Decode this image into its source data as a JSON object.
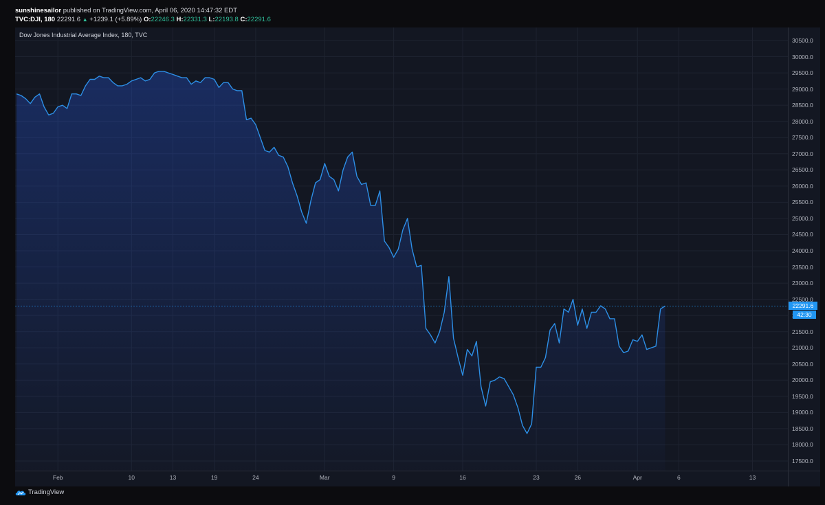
{
  "header": {
    "user": "sunshinesailor",
    "published": "published on TradingView.com, April 06, 2020 14:47:32 EDT",
    "symbol": "TVC:DJI, 180",
    "last": "22291.6",
    "change": "+1239.1 (+5.89%)",
    "o_label": "O:",
    "o_value": "22246.3",
    "h_label": "H:",
    "h_value": "22331.3",
    "l_label": "L:",
    "l_value": "22193.8",
    "c_label": "C:",
    "c_value": "22291.6"
  },
  "price_tag": "22291.6",
  "timer_tag": "42:30",
  "logo_text": "TradingView",
  "colors": {
    "line": "#2d8fe6",
    "accent": "#2196f3",
    "green": "#2fbf9b"
  },
  "chart_data": {
    "type": "area",
    "title": "Dow Jones Industrial Average Index, 180, TVC",
    "ylim": [
      17000,
      31000
    ],
    "yticks": [
      "30500.0",
      "30000.0",
      "29500.0",
      "29000.0",
      "28500.0",
      "28000.0",
      "27500.0",
      "27000.0",
      "26500.0",
      "26000.0",
      "25500.0",
      "25000.0",
      "24500.0",
      "24000.0",
      "23500.0",
      "23000.0",
      "22500.0",
      "22000.0",
      "21500.0",
      "21000.0",
      "20500.0",
      "20000.0",
      "19500.0",
      "19000.0",
      "18500.0",
      "18000.0",
      "17500.0"
    ],
    "xticks": [
      {
        "label": "Feb",
        "i": 9
      },
      {
        "label": "10",
        "i": 25
      },
      {
        "label": "13",
        "i": 34
      },
      {
        "label": "19",
        "i": 43
      },
      {
        "label": "24",
        "i": 52
      },
      {
        "label": "Mar",
        "i": 67
      },
      {
        "label": "9",
        "i": 82
      },
      {
        "label": "16",
        "i": 97
      },
      {
        "label": "23",
        "i": 113
      },
      {
        "label": "26",
        "i": 122
      },
      {
        "label": "Apr",
        "i": 135
      },
      {
        "label": "6",
        "i": 144
      },
      {
        "label": "13",
        "i": 160
      }
    ],
    "n_slots": 168,
    "last_value": 22291.6,
    "values": [
      28850,
      28800,
      28700,
      28550,
      28750,
      28850,
      28450,
      28200,
      28250,
      28450,
      28500,
      28400,
      28850,
      28850,
      28800,
      29100,
      29300,
      29300,
      29400,
      29350,
      29350,
      29200,
      29100,
      29100,
      29150,
      29250,
      29300,
      29350,
      29250,
      29300,
      29500,
      29550,
      29550,
      29500,
      29450,
      29400,
      29350,
      29350,
      29150,
      29250,
      29200,
      29350,
      29350,
      29300,
      29050,
      29200,
      29200,
      29000,
      28950,
      28950,
      28050,
      28100,
      27900,
      27500,
      27100,
      27050,
      27200,
      26950,
      26900,
      26600,
      26100,
      25700,
      25200,
      24850,
      25550,
      26100,
      26200,
      26700,
      26300,
      26200,
      25850,
      26500,
      26900,
      27050,
      26300,
      26050,
      26100,
      25400,
      25400,
      25850,
      24300,
      24100,
      23800,
      24050,
      24650,
      25000,
      24050,
      23500,
      23550,
      21600,
      21400,
      21150,
      21500,
      22100,
      23200,
      21300,
      20700,
      20150,
      20950,
      20750,
      21200,
      19800,
      19200,
      19950,
      20000,
      20100,
      20050,
      19800,
      19550,
      19150,
      18600,
      18350,
      18650,
      20400,
      20400,
      20700,
      21550,
      21750,
      21150,
      22200,
      22100,
      22500,
      21700,
      22200,
      21600,
      22100,
      22100,
      22300,
      22200,
      21900,
      21900,
      21050,
      20850,
      20900,
      21250,
      21200,
      21400,
      20950,
      21000,
      21050,
      22200,
      22291.6
    ]
  }
}
